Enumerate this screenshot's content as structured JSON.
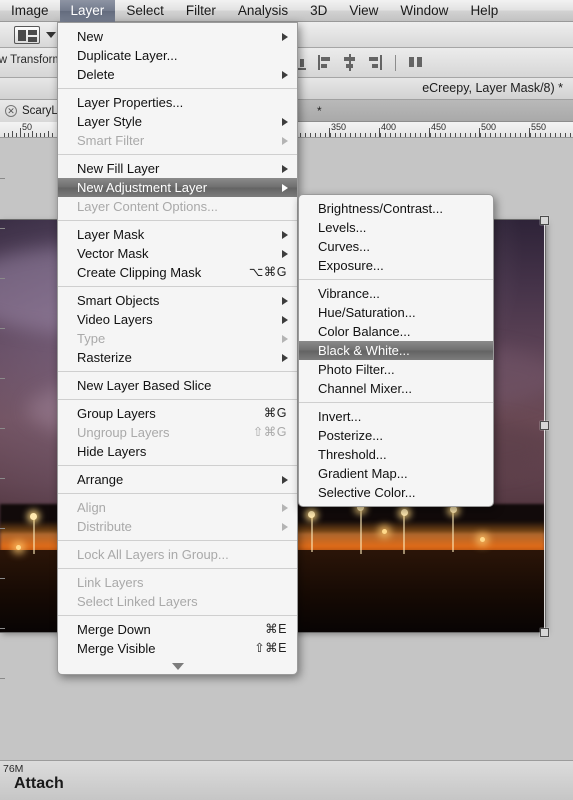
{
  "app": {
    "menubar": [
      {
        "label": "Image",
        "active": false
      },
      {
        "label": "Layer",
        "active": true
      },
      {
        "label": "Select",
        "active": false
      },
      {
        "label": "Filter",
        "active": false
      },
      {
        "label": "Analysis",
        "active": false
      },
      {
        "label": "3D",
        "active": false
      },
      {
        "label": "View",
        "active": false
      },
      {
        "label": "Window",
        "active": false
      },
      {
        "label": "Help",
        "active": false
      }
    ]
  },
  "options_bar": {
    "layout_icon": "layer-arrange-icon",
    "dropdown_caret": "chevron-down-icon",
    "show_transform_label": "how Transform",
    "align_icons": [
      "align-vertical-bottom-icon",
      "align-horizontal-left-icon",
      "align-horizontal-center-icon",
      "align-horizontal-right-icon",
      "distribute-horizontal-icon"
    ]
  },
  "document": {
    "title": "eCreepy, Layer Mask/8) *",
    "tab_label": "ScaryLig",
    "tab_close_icon": "close-icon",
    "tab_dirty_marker": "*",
    "ruler_labels": [
      "50",
      "350",
      "400",
      "450",
      "500",
      "550"
    ]
  },
  "status": {
    "doc_size": "76M",
    "attach_text": "Attach"
  },
  "menu": {
    "title": "Layer",
    "items": [
      {
        "label": "New",
        "submenu": true,
        "disabled": false,
        "selected": false
      },
      {
        "label": "Duplicate Layer...",
        "submenu": false,
        "disabled": false,
        "selected": false
      },
      {
        "label": "Delete",
        "submenu": true,
        "disabled": false,
        "selected": false
      },
      {
        "separator": true
      },
      {
        "label": "Layer Properties...",
        "submenu": false,
        "disabled": false,
        "selected": false
      },
      {
        "label": "Layer Style",
        "submenu": true,
        "disabled": false,
        "selected": false
      },
      {
        "label": "Smart Filter",
        "submenu": true,
        "disabled": true,
        "selected": false
      },
      {
        "separator": true
      },
      {
        "label": "New Fill Layer",
        "submenu": true,
        "disabled": false,
        "selected": false
      },
      {
        "label": "New Adjustment Layer",
        "submenu": true,
        "disabled": false,
        "selected": true
      },
      {
        "label": "Layer Content Options...",
        "submenu": false,
        "disabled": true,
        "selected": false
      },
      {
        "separator": true
      },
      {
        "label": "Layer Mask",
        "submenu": true,
        "disabled": false,
        "selected": false
      },
      {
        "label": "Vector Mask",
        "submenu": true,
        "disabled": false,
        "selected": false
      },
      {
        "label": "Create Clipping Mask",
        "shortcut": "⌥⌘G",
        "submenu": false,
        "disabled": false,
        "selected": false
      },
      {
        "separator": true
      },
      {
        "label": "Smart Objects",
        "submenu": true,
        "disabled": false,
        "selected": false
      },
      {
        "label": "Video Layers",
        "submenu": true,
        "disabled": false,
        "selected": false
      },
      {
        "label": "Type",
        "submenu": true,
        "disabled": true,
        "selected": false
      },
      {
        "label": "Rasterize",
        "submenu": true,
        "disabled": false,
        "selected": false
      },
      {
        "separator": true
      },
      {
        "label": "New Layer Based Slice",
        "submenu": false,
        "disabled": false,
        "selected": false
      },
      {
        "separator": true
      },
      {
        "label": "Group Layers",
        "shortcut": "⌘G",
        "submenu": false,
        "disabled": false,
        "selected": false
      },
      {
        "label": "Ungroup Layers",
        "shortcut": "⇧⌘G",
        "submenu": false,
        "disabled": true,
        "selected": false
      },
      {
        "label": "Hide Layers",
        "submenu": false,
        "disabled": false,
        "selected": false
      },
      {
        "separator": true
      },
      {
        "label": "Arrange",
        "submenu": true,
        "disabled": false,
        "selected": false
      },
      {
        "separator": true
      },
      {
        "label": "Align",
        "submenu": true,
        "disabled": true,
        "selected": false
      },
      {
        "label": "Distribute",
        "submenu": true,
        "disabled": true,
        "selected": false
      },
      {
        "separator": true
      },
      {
        "label": "Lock All Layers in Group...",
        "submenu": false,
        "disabled": true,
        "selected": false
      },
      {
        "separator": true
      },
      {
        "label": "Link Layers",
        "submenu": false,
        "disabled": true,
        "selected": false
      },
      {
        "label": "Select Linked Layers",
        "submenu": false,
        "disabled": true,
        "selected": false
      },
      {
        "separator": true
      },
      {
        "label": "Merge Down",
        "shortcut": "⌘E",
        "submenu": false,
        "disabled": false,
        "selected": false
      },
      {
        "label": "Merge Visible",
        "shortcut": "⇧⌘E",
        "submenu": false,
        "disabled": false,
        "selected": false
      }
    ],
    "scroll_down_icon": "triangle-down-icon"
  },
  "submenu": {
    "title": "New Adjustment Layer",
    "items": [
      {
        "label": "Brightness/Contrast...",
        "selected": false
      },
      {
        "label": "Levels...",
        "selected": false
      },
      {
        "label": "Curves...",
        "selected": false
      },
      {
        "label": "Exposure...",
        "selected": false
      },
      {
        "separator": true
      },
      {
        "label": "Vibrance...",
        "selected": false
      },
      {
        "label": "Hue/Saturation...",
        "selected": false
      },
      {
        "label": "Color Balance...",
        "selected": false
      },
      {
        "label": "Black & White...",
        "selected": true
      },
      {
        "label": "Photo Filter...",
        "selected": false
      },
      {
        "label": "Channel Mixer...",
        "selected": false
      },
      {
        "separator": true
      },
      {
        "label": "Invert...",
        "selected": false
      },
      {
        "label": "Posterize...",
        "selected": false
      },
      {
        "label": "Threshold...",
        "selected": false
      },
      {
        "label": "Gradient Map...",
        "selected": false
      },
      {
        "label": "Selective Color...",
        "selected": false
      }
    ]
  },
  "colors": {
    "menubar_active": "#727a8c",
    "menu_selected": "#6f6f6f",
    "menu_bg": "#f5f5f5",
    "disabled_text": "#a9a9a9",
    "lips_red": "#d9205a",
    "city_light": "#ffd98a"
  }
}
